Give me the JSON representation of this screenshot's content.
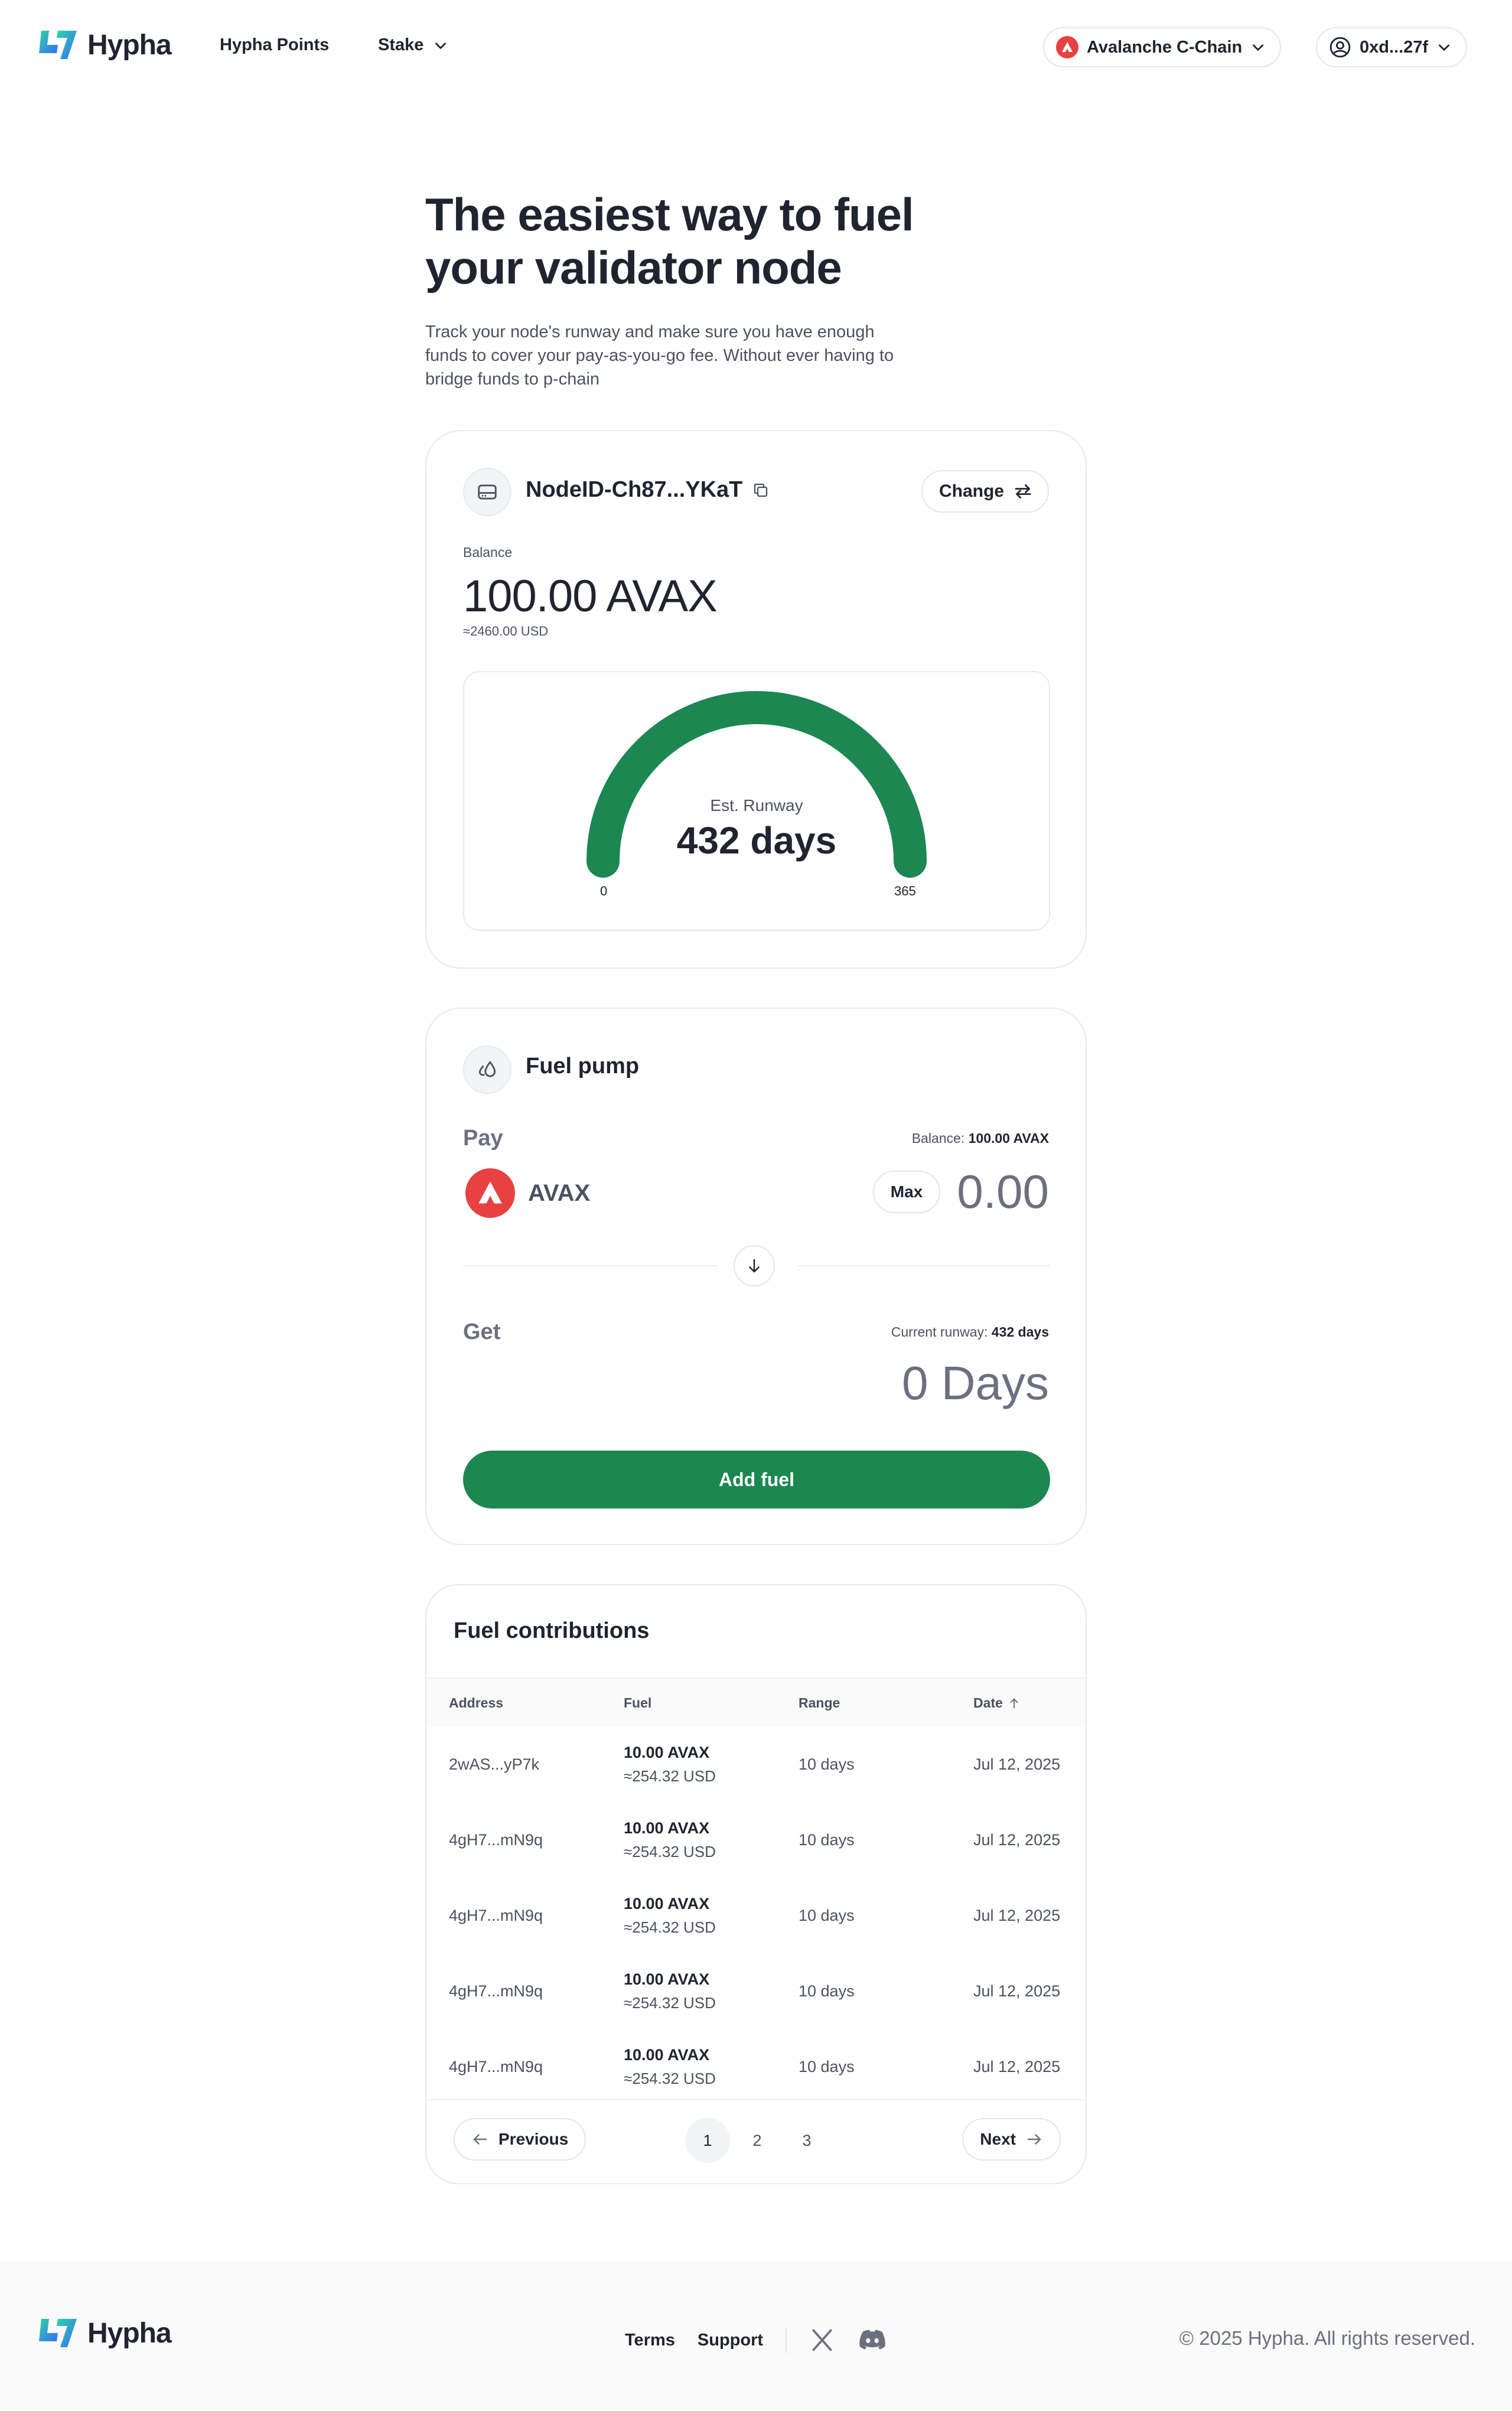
{
  "brand": {
    "name": "Hypha",
    "colors": {
      "primary": "#1c8751",
      "avalanche": "#e84142",
      "logo_teal": "#2bd4a8",
      "logo_blue": "#3b6cf6"
    }
  },
  "nav": {
    "points_label": "Hypha Points",
    "stake_label": "Stake",
    "chain_label": "Avalanche C-Chain",
    "wallet_label": "0xd...27f"
  },
  "hero": {
    "title_line1": "The easiest way to fuel",
    "title_line2": "your validator node",
    "subtitle_line1": "Track your node's runway and make sure you have enough",
    "subtitle_line2": "funds to cover your pay-as-you-go fee. Without ever having to",
    "subtitle_line3": "bridge funds to p-chain"
  },
  "node": {
    "id": "NodeID-Ch87...YKaT",
    "change_label": "Change",
    "balance_label": "Balance",
    "balance_value": "100.00 AVAX",
    "balance_usd": "≈2460.00 USD",
    "runway_label": "Est. Runway",
    "runway_value": "432 days",
    "gauge_min": "0",
    "gauge_max": "365",
    "gauge_fill_fraction": 1.0
  },
  "pump": {
    "title": "Fuel pump",
    "pay_label": "Pay",
    "balance_prefix": "Balance:",
    "balance_value": "100.00 AVAX",
    "token": "AVAX",
    "max_label": "Max",
    "pay_amount": "0.00",
    "get_label": "Get",
    "runway_prefix": "Current runway:",
    "runway_value": "432 days",
    "get_amount": "0 Days",
    "submit_label": "Add fuel"
  },
  "contributions": {
    "title": "Fuel contributions",
    "columns": {
      "address": "Address",
      "fuel": "Fuel",
      "range": "Range",
      "date": "Date"
    },
    "rows": [
      {
        "address": "2wAS...yP7k",
        "fuel": "10.00 AVAX",
        "fuel_usd": "≈254.32 USD",
        "range": "10 days",
        "date": "Jul 12, 2025"
      },
      {
        "address": "4gH7...mN9q",
        "fuel": "10.00 AVAX",
        "fuel_usd": "≈254.32 USD",
        "range": "10 days",
        "date": "Jul 12, 2025"
      },
      {
        "address": "4gH7...mN9q",
        "fuel": "10.00 AVAX",
        "fuel_usd": "≈254.32 USD",
        "range": "10 days",
        "date": "Jul 12, 2025"
      },
      {
        "address": "4gH7...mN9q",
        "fuel": "10.00 AVAX",
        "fuel_usd": "≈254.32 USD",
        "range": "10 days",
        "date": "Jul 12, 2025"
      },
      {
        "address": "4gH7...mN9q",
        "fuel": "10.00 AVAX",
        "fuel_usd": "≈254.32 USD",
        "range": "10 days",
        "date": "Jul 12, 2025"
      }
    ],
    "pagination": {
      "prev_label": "Previous",
      "next_label": "Next",
      "pages": [
        "1",
        "2",
        "3"
      ],
      "current": "1"
    }
  },
  "footer": {
    "terms_label": "Terms",
    "support_label": "Support",
    "copyright": "© 2025 Hypha. All rights reserved."
  }
}
